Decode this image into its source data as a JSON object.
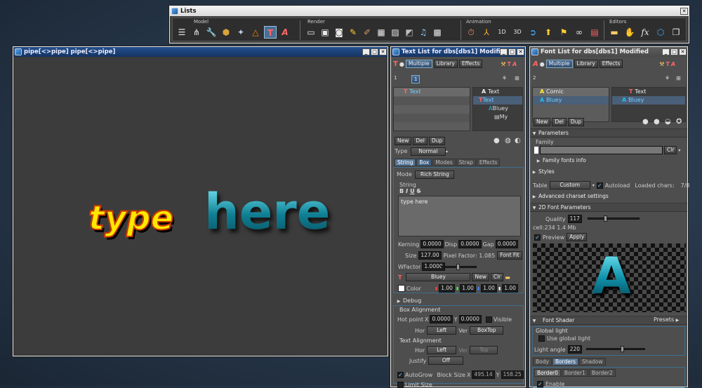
{
  "lists": {
    "title": "Lists",
    "groups": {
      "model": {
        "label": "Model",
        "icons": [
          "menu-icon",
          "hierarchy-icon",
          "wrench-icon",
          "cube-icon",
          "puzzle-icon",
          "triangle-icon",
          "text-T-icon",
          "text-A-icon"
        ]
      },
      "render": {
        "label": "Render",
        "icons": [
          "monitor-icon",
          "box-icon",
          "camera-icon",
          "bulb-icon",
          "brush-icon",
          "image-icon",
          "picture-icon",
          "paint-icon",
          "music-icon",
          "grid-icon"
        ]
      },
      "animation": {
        "label": "Animation",
        "icons": [
          "stopwatch-icon",
          "axes-icon",
          "anim-1d-icon",
          "anim-3d-icon",
          "play-circle-icon",
          "marker-icon",
          "flag-icon",
          "link-icon",
          "note-icon"
        ]
      },
      "editors": {
        "label": "Editors",
        "icons": [
          "folder-icon",
          "hand-icon",
          "fx-icon",
          "cube-blue-icon",
          "layers-icon"
        ]
      }
    }
  },
  "viewport": {
    "title": "pipe[<>pipe] pipe[<>pipe]",
    "text_yellow": "type",
    "text_blue": "here"
  },
  "textlist": {
    "title": "Text List for dbs[dbs1] Modified",
    "mode_buttons": [
      "Multiple",
      "Library",
      "Effects"
    ],
    "level": "1",
    "page_num": "1",
    "left_items": [
      "Text"
    ],
    "tree_items": [
      "Text",
      "Text",
      "Bluey",
      "My"
    ],
    "actions": [
      "New",
      "Del",
      "Dup"
    ],
    "type_label": "Type",
    "type_value": "Normal",
    "tabs": [
      "String",
      "Box",
      "Modes",
      "Strap",
      "Effects"
    ],
    "mode_label": "Mode",
    "mode_value": "Rich String",
    "string_label": "String",
    "format": [
      "B",
      "I",
      "U",
      "S"
    ],
    "string_value": "type here",
    "kerning_label": "Kerning",
    "kerning": "0.0000",
    "disp_label": "Disp",
    "disp": "0.0000",
    "gap_label": "Gap",
    "gap": "0.0000",
    "size_label": "Size",
    "size": "127.00",
    "pixel_factor": "Pixel Factor: 1.085",
    "fontfit": "Font Fit",
    "wfactor_label": "WFactor",
    "wfactor": "1.0000",
    "font_name": "Bluey",
    "font_new": "New",
    "font_clr": "Clr",
    "color_label": "Color",
    "color_values": [
      "1.00",
      "1.00",
      "1.00",
      "1.00"
    ],
    "debug": "Debug",
    "box_alignment": "Box Alignment",
    "hotpoint_label": "Hot point",
    "hp_x_label": "X",
    "hp_x": "0.0000",
    "hp_y_label": "Y",
    "hp_y": "0.0000",
    "visible": "Visible",
    "hor_label": "Hor",
    "hor_value": "Left",
    "ver_label": "Ver",
    "ver_value": "BoxTop",
    "text_alignment": "Text Alignment",
    "t_hor_label": "Hor",
    "t_hor_value": "Left",
    "t_ver_label": "Ver",
    "t_ver_value": "Top",
    "justify_label": "Justify",
    "justify_value": "Off",
    "autogrow": "AutoGrow",
    "blocksize_label": "Block Size",
    "bs_x_label": "X",
    "bs_x": "495.14",
    "bs_y_label": "Y",
    "bs_y": "158.25",
    "limit_size": "Limit Size"
  },
  "fontlist": {
    "title": "Font List for dbs[dbs1] Modified",
    "mode_buttons": [
      "Multiple",
      "Library",
      "Effects"
    ],
    "level": "2",
    "left_items": [
      "Comic",
      "Bluey"
    ],
    "tree_items": [
      "Text",
      "Bluey"
    ],
    "actions": [
      "New",
      "Del",
      "Dup"
    ],
    "parameters": "Parameters",
    "family_label": "Family",
    "family_clr": "Clr",
    "family_fonts_info": "Family fonts info",
    "styles": "Styles",
    "table_label": "Table",
    "table_value": "Custom",
    "autoload": "Autoload",
    "loaded_chars": "Loaded chars:",
    "loaded_value": "7/8",
    "advanced_charset": "Advanced charset settings",
    "font2d": "2D Font Parameters",
    "quality_label": "Quality",
    "quality": "117",
    "cell_info": "cell:234  1.4 Mb",
    "preview": "Preview",
    "apply": "Apply",
    "preview_letter": "A",
    "font_shader": "Font Shader",
    "presets": "Presets",
    "global_light": "Global light",
    "use_global_light": "Use global light",
    "light_angle_label": "Light angle",
    "light_angle": "220",
    "tabs": [
      "Body",
      "Borders",
      "Shadow"
    ],
    "subtabs": [
      "Border0",
      "Border1",
      "Border2"
    ],
    "enable": "Enable"
  },
  "colors": {
    "accent": "#4a6f95",
    "title_blue": "#1e4a85",
    "yellow": "#ffe800",
    "teal": "#1ab0c8"
  }
}
